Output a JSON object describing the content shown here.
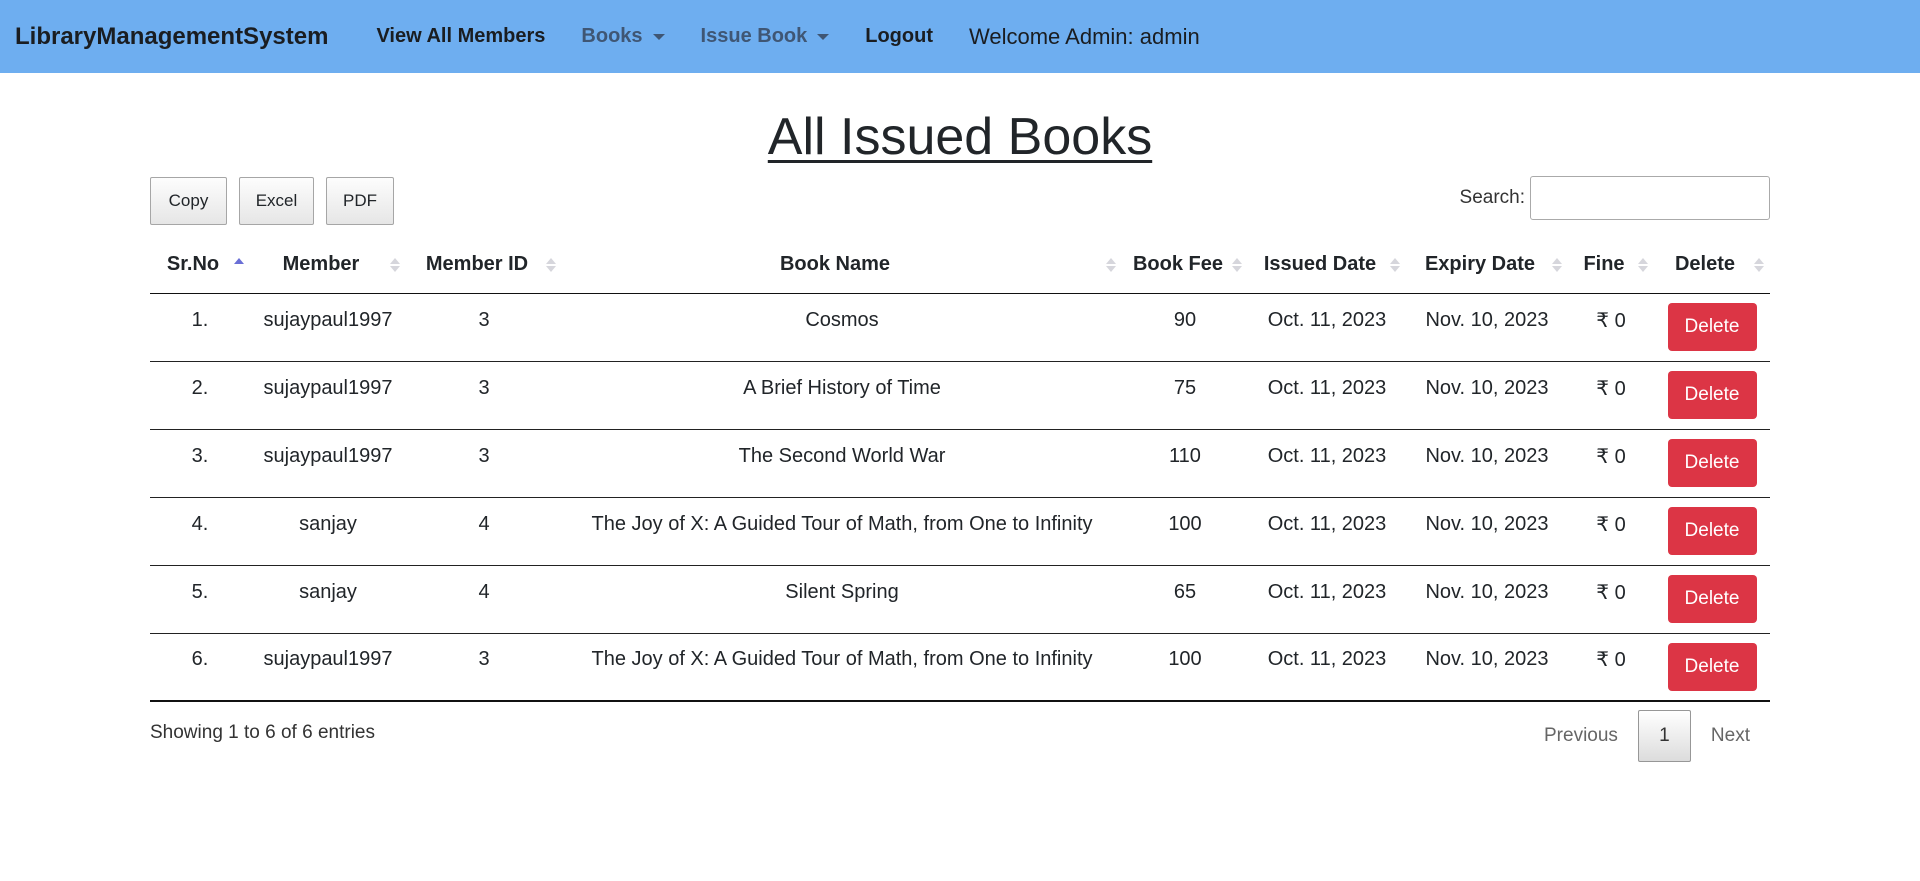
{
  "navbar": {
    "brand": "LibraryManagementSystem",
    "items": [
      {
        "label": "View All Members"
      },
      {
        "label": "Books"
      },
      {
        "label": "Issue Book"
      },
      {
        "label": "Logout"
      }
    ],
    "welcome": "Welcome Admin: admin"
  },
  "page": {
    "title": "All Issued Books"
  },
  "toolbar": {
    "copy": "Copy",
    "excel": "Excel",
    "pdf": "PDF",
    "search_label": "Search:",
    "search_value": ""
  },
  "table": {
    "headers": [
      "Sr.No",
      "Member",
      "Member ID",
      "Book Name",
      "Book Fee",
      "Issued Date",
      "Expiry Date",
      "Fine",
      "Delete"
    ],
    "rows": [
      {
        "sr": "1.",
        "member": "sujaypaul1997",
        "member_id": "3",
        "book": "Cosmos",
        "fee": "90",
        "issued": "Oct. 11, 2023",
        "expiry": "Nov. 10, 2023",
        "fine": "₹ 0",
        "action": "Delete"
      },
      {
        "sr": "2.",
        "member": "sujaypaul1997",
        "member_id": "3",
        "book": "A Brief History of Time",
        "fee": "75",
        "issued": "Oct. 11, 2023",
        "expiry": "Nov. 10, 2023",
        "fine": "₹ 0",
        "action": "Delete"
      },
      {
        "sr": "3.",
        "member": "sujaypaul1997",
        "member_id": "3",
        "book": "The Second World War",
        "fee": "110",
        "issued": "Oct. 11, 2023",
        "expiry": "Nov. 10, 2023",
        "fine": "₹ 0",
        "action": "Delete"
      },
      {
        "sr": "4.",
        "member": "sanjay",
        "member_id": "4",
        "book": "The Joy of X: A Guided Tour of Math, from One to Infinity",
        "fee": "100",
        "issued": "Oct. 11, 2023",
        "expiry": "Nov. 10, 2023",
        "fine": "₹ 0",
        "action": "Delete"
      },
      {
        "sr": "5.",
        "member": "sanjay",
        "member_id": "4",
        "book": "Silent Spring",
        "fee": "65",
        "issued": "Oct. 11, 2023",
        "expiry": "Nov. 10, 2023",
        "fine": "₹ 0",
        "action": "Delete"
      },
      {
        "sr": "6.",
        "member": "sujaypaul1997",
        "member_id": "3",
        "book": "The Joy of X: A Guided Tour of Math, from One to Infinity",
        "fee": "100",
        "issued": "Oct. 11, 2023",
        "expiry": "Nov. 10, 2023",
        "fine": "₹ 0",
        "action": "Delete"
      }
    ]
  },
  "footer": {
    "info": "Showing 1 to 6 of 6 entries",
    "previous": "Previous",
    "current_page": "1",
    "next": "Next"
  },
  "colors": {
    "navbar_bg": "#6eaef0",
    "delete_button": "#dc3545",
    "sort_active": "#6a6fd6"
  },
  "icons": {
    "dropdown": "caret-down-icon",
    "sort": "sort-arrows-icon"
  }
}
